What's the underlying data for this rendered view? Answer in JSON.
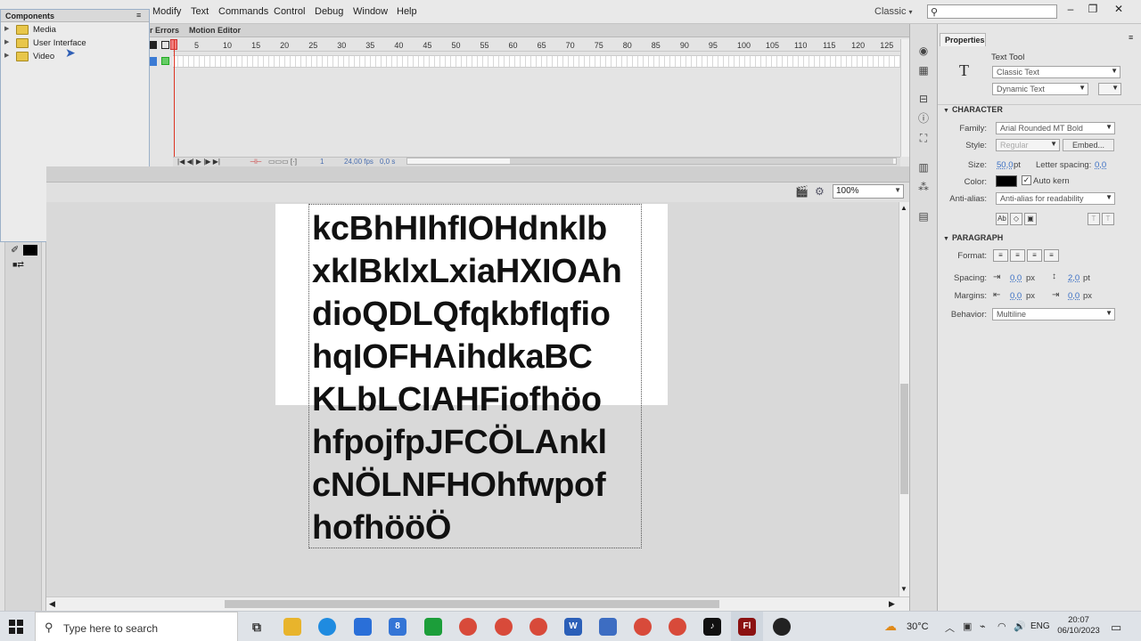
{
  "menu": [
    "Modify",
    "Text",
    "Commands",
    "Control",
    "Debug",
    "Window",
    "Help"
  ],
  "workspace": "Classic",
  "window_controls": [
    "–",
    "❐",
    "✕"
  ],
  "components_panel": {
    "title": "Components",
    "items": [
      {
        "label": "Media"
      },
      {
        "label": "User Interface"
      },
      {
        "label": "Video"
      }
    ]
  },
  "timeline": {
    "tabs": [
      "r Errors",
      "Motion Editor"
    ],
    "ruler_ticks": [
      "5",
      "10",
      "15",
      "20",
      "25",
      "30",
      "35",
      "40",
      "45",
      "50",
      "55",
      "60",
      "65",
      "70",
      "75",
      "80",
      "85",
      "90",
      "95",
      "100",
      "105",
      "110",
      "115",
      "120",
      "125"
    ],
    "current_frame": "1",
    "fps": "24,00 fps",
    "time": "0,0 s"
  },
  "stage": {
    "zoom": "100%",
    "text_lines": [
      "kcBhHIhfIOHdnklb",
      "xklBklxLxiaHXIOAh",
      "dioQDLQfqkbfIqfio",
      "hqIOFHAihdkaBC",
      "KLbLCIAHFiofhöo",
      "hfpojfpJFCÖLAnkl",
      "cNÖLNFHOhfwpof",
      "hofhööÖ"
    ]
  },
  "properties": {
    "tab": "Properties",
    "tool_name": "Text Tool",
    "text_engine": "Classic Text",
    "text_type": "Dynamic Text",
    "character": {
      "section": "CHARACTER",
      "family_label": "Family:",
      "family": "Arial Rounded MT Bold",
      "style_label": "Style:",
      "style": "Regular",
      "embed": "Embed...",
      "size_label": "Size:",
      "size": "50,0",
      "size_unit": "pt",
      "letter_spacing_label": "Letter spacing:",
      "letter_spacing": "0,0",
      "color_label": "Color:",
      "color": "#000000",
      "auto_kern": "Auto kern",
      "antialias_label": "Anti-alias:",
      "antialias": "Anti-alias for readability"
    },
    "paragraph": {
      "section": "PARAGRAPH",
      "format_label": "Format:",
      "spacing_label": "Spacing:",
      "spacing_indent": "0,0",
      "spacing_indent_unit": "px",
      "line_spacing": "2,0",
      "line_spacing_unit": "pt",
      "margins_label": "Margins:",
      "margin_left": "0,0",
      "margin_left_unit": "px",
      "margin_right": "0,0",
      "margin_right_unit": "px",
      "behavior_label": "Behavior:",
      "behavior": "Multiline"
    }
  },
  "taskbar": {
    "search_placeholder": "Type here to search",
    "mail_badge": "8",
    "temperature": "30°C",
    "language": "ENG",
    "time": "20:07",
    "date": "06/10/2023"
  }
}
